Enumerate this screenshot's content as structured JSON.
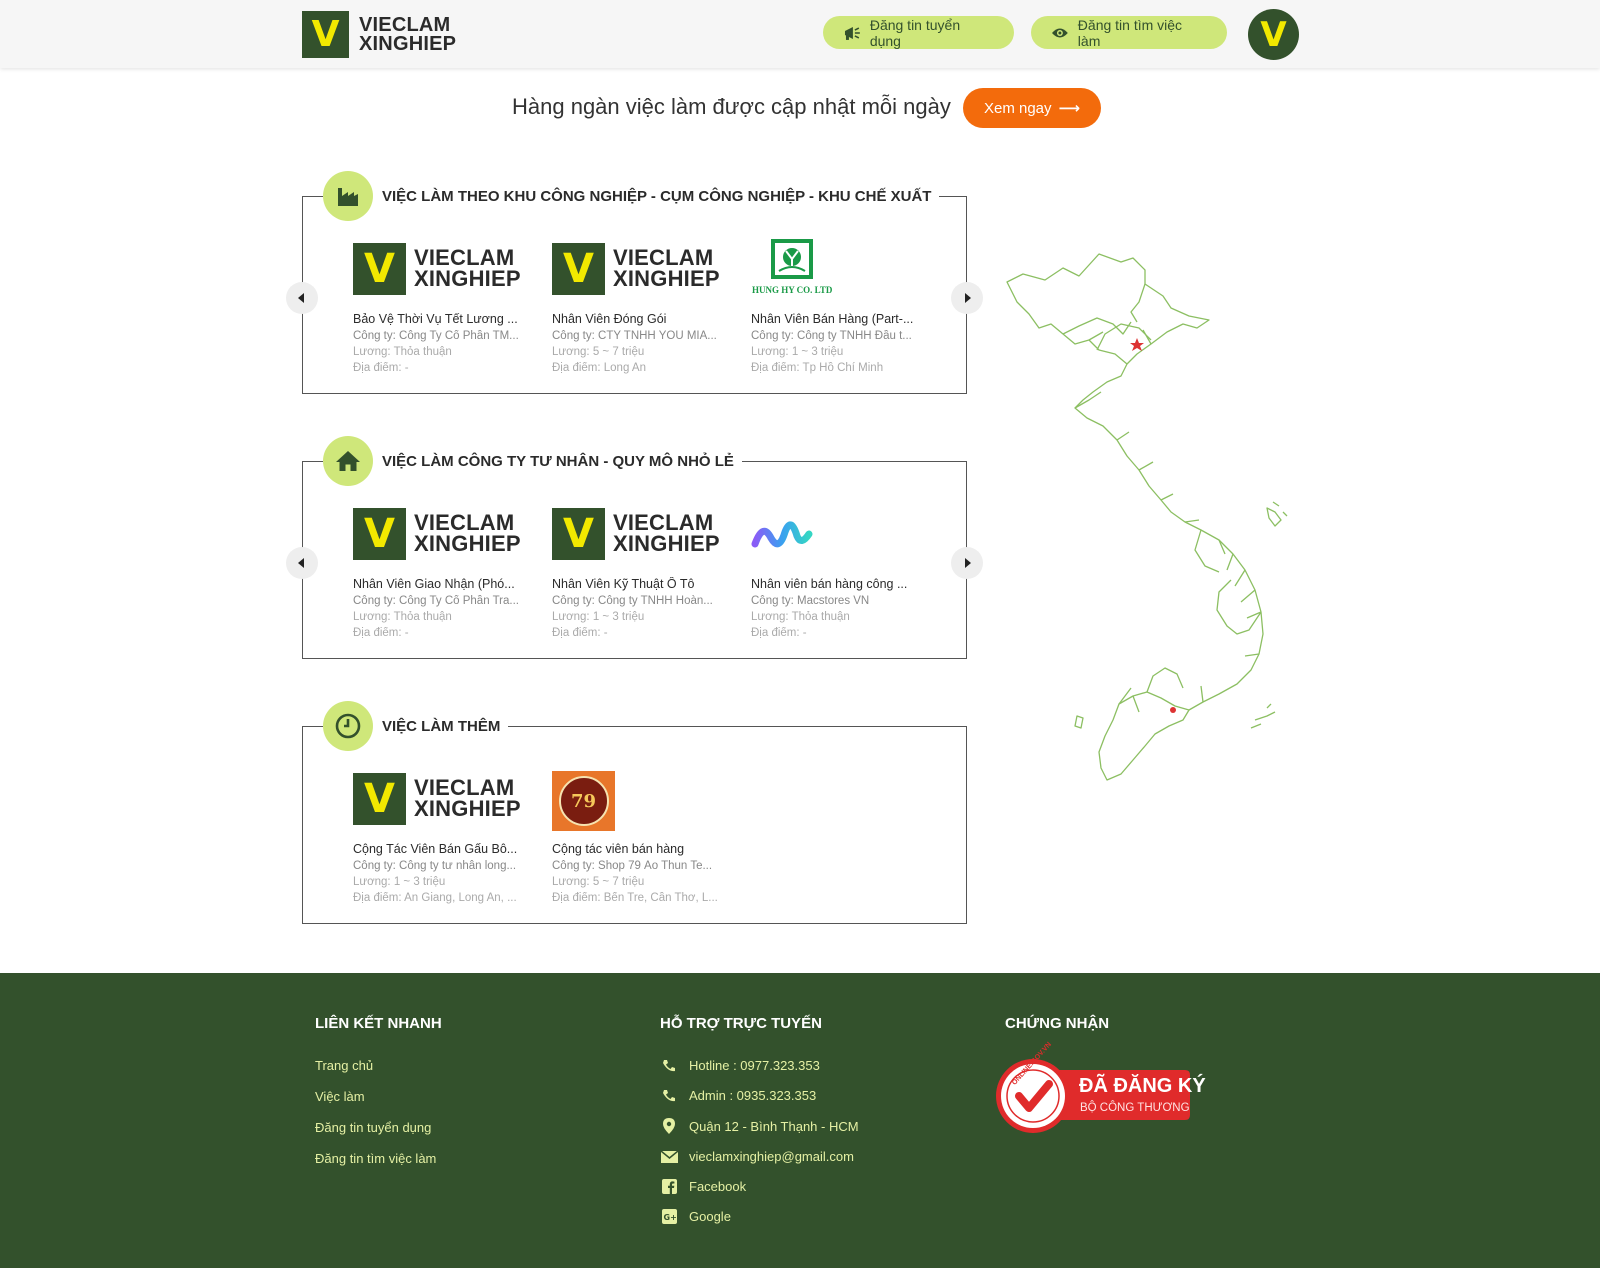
{
  "header": {
    "logo_line1": "VIECLAM",
    "logo_line2": "XINGHIEP",
    "logo_letter": "V",
    "btn_post_job": "Đăng tin tuyển dụng",
    "btn_post_resume": "Đăng tin tìm việc làm",
    "avatar_letter": "V"
  },
  "banner": {
    "tagline": "Hàng ngàn việc làm được cập nhật mỗi ngày",
    "cta_label": "Xem ngay",
    "cta_arrow": "⟶"
  },
  "colors": {
    "brand_green": "#33512c",
    "accent_lime": "#cfe77a",
    "brand_yellow": "#f2e900",
    "cta_orange": "#f36b0c"
  },
  "sections": [
    {
      "title": "VIỆC LÀM THEO KHU CÔNG NGHIỆP - CỤM CÔNG NGHIỆP - KHU CHẾ XUẤT",
      "icon": "factory-icon",
      "jobs": [
        {
          "logo": "vieclam-logo",
          "title": "Bảo Vệ Thời Vụ Tết Lương ...",
          "company": "Công ty: Công Ty Cổ Phần TM...",
          "salary": "Lương: Thỏa thuận",
          "location": "Địa điểm: -"
        },
        {
          "logo": "vieclam-logo",
          "title": "Nhân Viên Đóng Gói",
          "company": "Công ty: CTY TNHH YOU MIA...",
          "salary": "Lương: 5 ~ 7 triệu",
          "location": "Địa điểm: Long An"
        },
        {
          "logo": "hunghy-logo",
          "logo_text": "HUNG HY CO. LTD",
          "title": "Nhân Viên Bán Hàng (Part-...",
          "company": "Công ty: Công ty TNHH Đầu t...",
          "salary": "Lương: 1 ~ 3 triệu",
          "location": "Địa điểm: Tp Hồ Chí Minh"
        }
      ]
    },
    {
      "title": "VIỆC LÀM CÔNG TY TƯ NHÂN - QUY MÔ NHỎ LẺ",
      "icon": "home-icon",
      "jobs": [
        {
          "logo": "vieclam-logo",
          "title": "Nhân Viên Giao Nhận (Phó...",
          "company": "Công ty: Công Ty Cổ Phần Tra...",
          "salary": "Lương: Thỏa thuận",
          "location": "Địa điểm: -"
        },
        {
          "logo": "vieclam-logo",
          "title": "Nhân Viên Kỹ Thuật Ô Tô",
          "company": "Công ty: Công ty TNHH Hoàn...",
          "salary": "Lương: 1 ~ 3 triệu",
          "location": "Địa điểm: -"
        },
        {
          "logo": "macstores-logo",
          "title": "Nhân viên bán hàng công ...",
          "company": "Công ty: Macstores VN",
          "salary": "Lương: Thỏa thuận",
          "location": "Địa điểm: -"
        }
      ]
    },
    {
      "title": "VIỆC LÀM THÊM",
      "icon": "clock-icon",
      "jobs": [
        {
          "logo": "vieclam-logo",
          "title": "Cộng Tác Viên Bán Gấu Bô...",
          "company": "Công ty: Công ty tư nhân long...",
          "salary": "Lương: 1 ~ 3 triệu",
          "location": "Địa điểm: An Giang, Long An, ..."
        },
        {
          "logo": "shop79-logo",
          "logo_text": "79",
          "title": "Cộng tác viên bán hàng",
          "company": "Công ty: Shop 79 Áo Thun Te...",
          "salary": "Lương: 5 ~ 7 triệu",
          "location": "Địa điểm: Bến Tre, Cần Thơ, L..."
        }
      ]
    }
  ],
  "footer": {
    "links_title": "LIÊN KẾT NHANH",
    "links": [
      "Trang chủ",
      "Việc làm",
      "Đăng tin tuyển dụng",
      "Đăng tin tìm việc làm"
    ],
    "support_title": "HỖ TRỢ TRỰC TUYẾN",
    "support": [
      {
        "icon": "phone-icon",
        "text": "Hotline : 0977.323.353"
      },
      {
        "icon": "phone-icon",
        "text": "Admin : 0935.323.353"
      },
      {
        "icon": "map-pin-icon",
        "text": "Quận 12 - Bình Thạnh - HCM"
      },
      {
        "icon": "mail-icon",
        "text": "vieclamxinghiep@gmail.com"
      },
      {
        "icon": "facebook-icon",
        "text": "Facebook"
      },
      {
        "icon": "google-plus-icon",
        "text": "Google"
      }
    ],
    "cert_title": "CHỨNG NHẬN",
    "cert_line1": "ĐÃ ĐĂNG KÝ",
    "cert_line2": "BỘ CÔNG THƯƠNG",
    "cert_ring": "ONLINE.GOV.VN"
  }
}
